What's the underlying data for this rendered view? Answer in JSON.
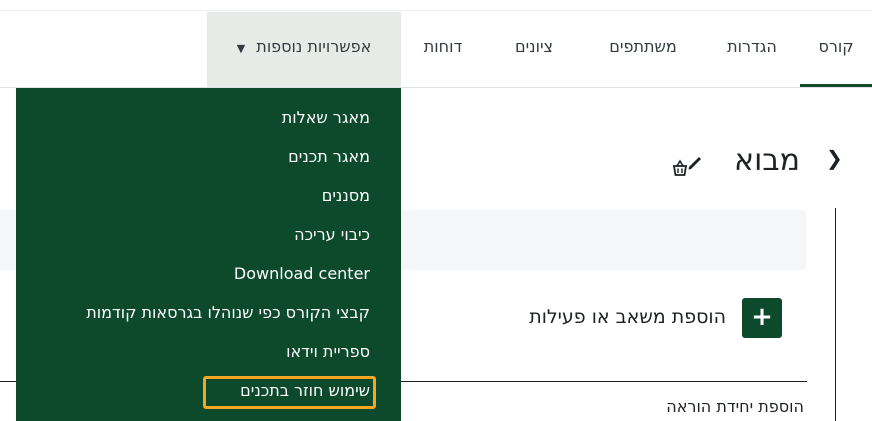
{
  "tabs": {
    "course": "קורס",
    "settings": "הגדרות",
    "participants": "משתתפים",
    "grades": "ציונים",
    "reports": "דוחות",
    "more": "אפשרויות נוספות"
  },
  "dropdown": {
    "items": [
      "מאגר שאלות",
      "מאגר תכנים",
      "מסננים",
      "כיבוי עריכה",
      "Download center",
      "קבצי הקורס כפי שנוהלו בגרסאות קודמות",
      "ספריית וידאו",
      "שימוש חוזר בתכנים"
    ],
    "highlight_color": "#f5a623"
  },
  "section": {
    "title": "מבוא",
    "add_label": "הוספת משאב או פעילות",
    "add_unit_label": "הוספת יחידת הוראה"
  },
  "colors": {
    "brand": "#0c4a2b"
  }
}
